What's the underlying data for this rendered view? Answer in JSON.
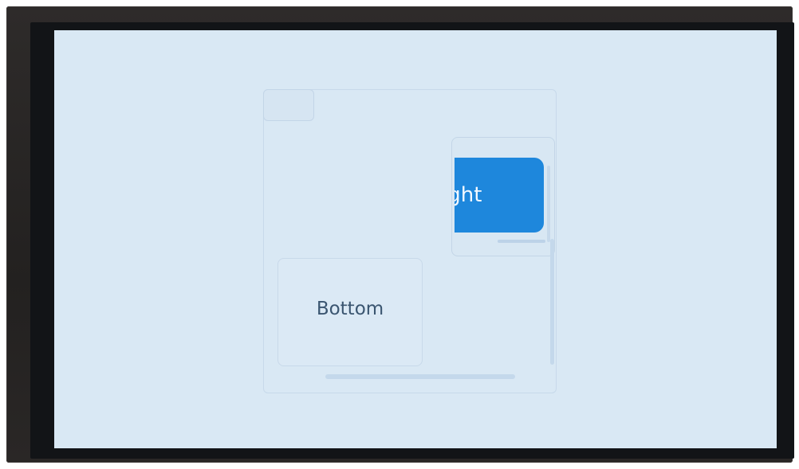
{
  "screen": {
    "background_color": "#d9e8f4"
  },
  "scroll_panel": {
    "right_button": {
      "label": "Right",
      "color": "#1e87dc"
    },
    "bottom_card": {
      "label": "Bottom"
    }
  }
}
